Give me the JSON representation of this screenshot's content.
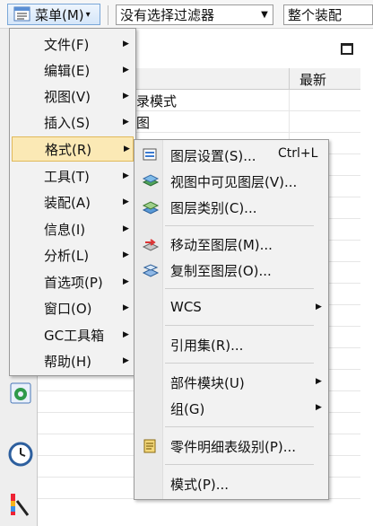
{
  "toolbar": {
    "menu_label": "菜单(M)",
    "menu_caret": "▾",
    "filter_value": "没有选择过滤器",
    "filter_arrow": "▼",
    "assembly_value": "整个装配"
  },
  "navigator": {
    "column_latest": "最新",
    "row1_text": "录模式",
    "row2_text": "图"
  },
  "main_menu": [
    {
      "label": "文件(F)",
      "arrow": "▶"
    },
    {
      "label": "编辑(E)",
      "arrow": "▶"
    },
    {
      "label": "视图(V)",
      "arrow": "▶"
    },
    {
      "label": "插入(S)",
      "arrow": "▶"
    },
    {
      "label": "格式(R)",
      "arrow": "▶"
    },
    {
      "label": "工具(T)",
      "arrow": "▶"
    },
    {
      "label": "装配(A)",
      "arrow": "▶"
    },
    {
      "label": "信息(I)",
      "arrow": "▶"
    },
    {
      "label": "分析(L)",
      "arrow": "▶"
    },
    {
      "label": "首选项(P)",
      "arrow": "▶"
    },
    {
      "label": "窗口(O)",
      "arrow": "▶"
    },
    {
      "label": "GC工具箱",
      "arrow": "▶"
    },
    {
      "label": "帮助(H)",
      "arrow": "▶"
    }
  ],
  "format_submenu": {
    "layer_settings": {
      "label": "图层设置(S)...",
      "shortcut": "Ctrl+L",
      "icon": "layer-settings-icon"
    },
    "visible_layers": {
      "label": "视图中可见图层(V)...",
      "icon": "visible-layers-icon"
    },
    "layer_category": {
      "label": "图层类别(C)...",
      "icon": "layer-category-icon"
    },
    "move_to_layer": {
      "label": "移动至图层(M)...",
      "icon": "move-to-layer-icon"
    },
    "copy_to_layer": {
      "label": "复制至图层(O)...",
      "icon": "copy-to-layer-icon"
    },
    "wcs": {
      "label": "WCS",
      "arrow": "▶"
    },
    "reference_set": {
      "label": "引用集(R)..."
    },
    "part_module": {
      "label": "部件模块(U)",
      "arrow": "▶"
    },
    "group": {
      "label": "组(G)",
      "arrow": "▶"
    },
    "parts_list_level": {
      "label": "零件明细表级别(P)...",
      "icon": "parts-list-icon"
    },
    "mode": {
      "label": "模式(P)..."
    }
  },
  "colors": {
    "highlight_bg": "#fbe9b5",
    "highlight_border": "#e0b95a",
    "menu_bg": "#f2f2f2"
  }
}
